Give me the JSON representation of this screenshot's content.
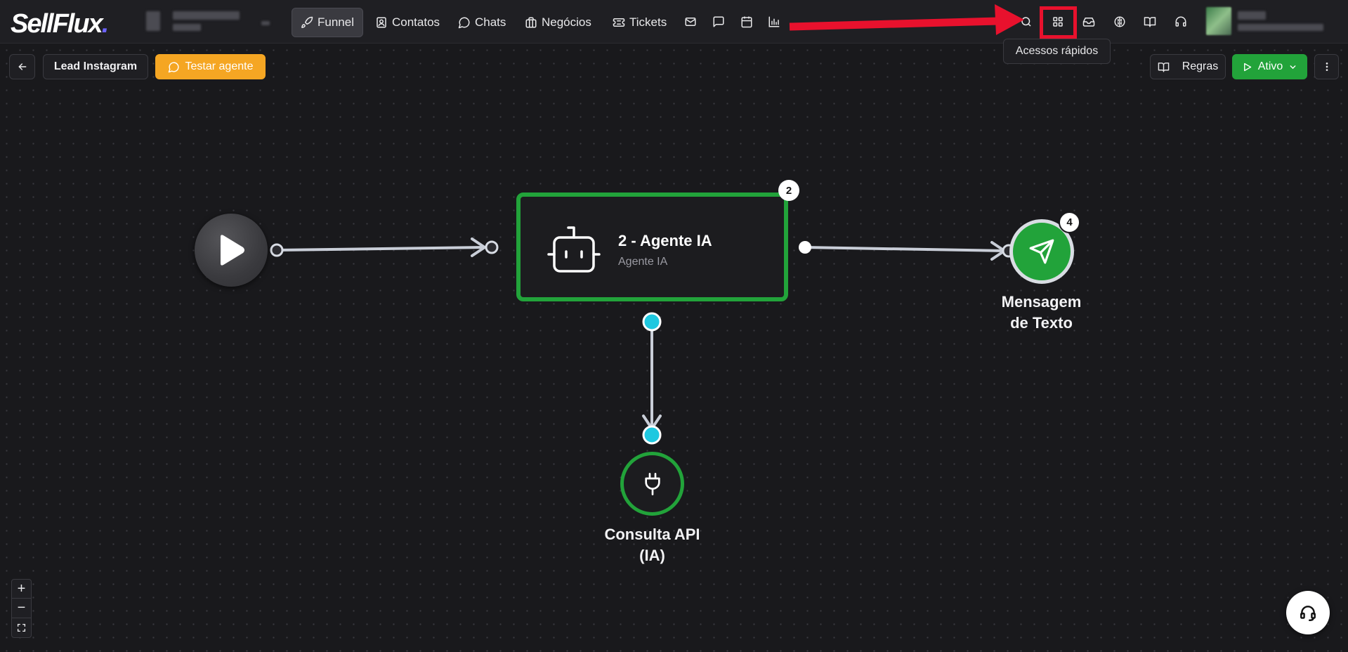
{
  "app": {
    "logo_text": "SellFlux",
    "logo_dot": "."
  },
  "nav": [
    {
      "label": "Funnel",
      "icon": "rocket-icon",
      "active": true
    },
    {
      "label": "Contatos",
      "icon": "contacts-icon"
    },
    {
      "label": "Chats",
      "icon": "chat-bubble-icon"
    },
    {
      "label": "Negócios",
      "icon": "briefcase-icon"
    },
    {
      "label": "Tickets",
      "icon": "ticket-icon"
    }
  ],
  "tooltip": "Acessos rápidos",
  "toolbar": {
    "breadcrumb": "Lead Instagram",
    "test_agent": "Testar agente",
    "rules": "Regras",
    "status": "Ativo"
  },
  "nodes": {
    "agent": {
      "badge": "2",
      "title": "2 - Agente IA",
      "subtitle": "Agente IA"
    },
    "message": {
      "badge": "4",
      "label_line1": "Mensagem",
      "label_line2": "de Texto"
    },
    "api": {
      "label_line1": "Consulta API",
      "label_line2": "(IA)"
    }
  },
  "zoom": {
    "in": "+",
    "out": "−"
  },
  "colors": {
    "accent_green": "#22a33a",
    "accent_orange": "#f5a623",
    "port_cyan": "#1ec8e0",
    "annotation_red": "#e8112d"
  }
}
